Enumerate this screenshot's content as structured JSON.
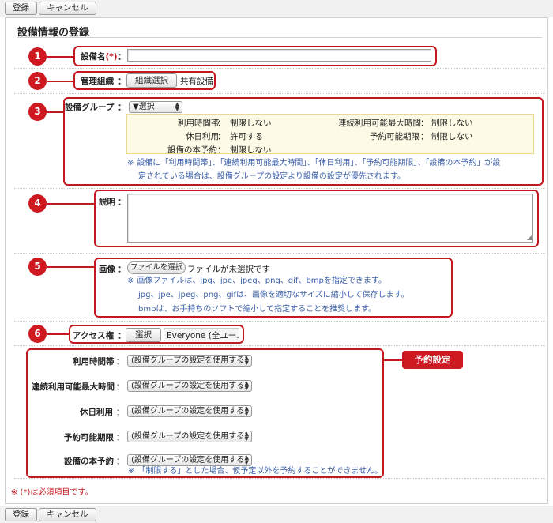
{
  "toolbar": {
    "register": "登録",
    "cancel": "キャンセル"
  },
  "page_title": "設備情報の登録",
  "badges": [
    "1",
    "2",
    "3",
    "4",
    "5",
    "6"
  ],
  "facility_name": {
    "label": "設備名",
    "required_mark": "(*)",
    "value": ""
  },
  "org": {
    "label": "管理組織",
    "button": "組織選択",
    "value": "共有設備"
  },
  "group": {
    "label": "設備グループ",
    "select": "▼選択",
    "details": [
      {
        "label": "利用時間帯",
        "value": "制限しない"
      },
      {
        "label": "連続利用可能最大時間",
        "value": "制限しない"
      },
      {
        "label": "休日利用",
        "value": "許可する"
      },
      {
        "label": "予約可能期限",
        "value": "制限しない"
      },
      {
        "label": "設備の本予約",
        "value": "制限しない"
      }
    ],
    "note_line1": "設備に「利用時間帯」、「連続利用可能最大時間」、「休日利用」、「予約可能期限」、「設備の本予約」が設",
    "note_line2": "定されている場合は、設備グループの設定より設備の設定が優先されます。"
  },
  "description": {
    "label": "説明",
    "value": ""
  },
  "image": {
    "label": "画像",
    "file_button": "ファイルを選択",
    "file_status": "ファイルが未選択です",
    "note1": "画像ファイルは、jpg、jpe、jpeg、png、gif、bmpを指定できます。",
    "note2": "jpg、jpe、jpeg、png、gifは、画像を適切なサイズに縮小して保存します。",
    "note3": "bmpは、お手持ちのソフトで縮小して指定することを推奨します。"
  },
  "access": {
    "label": "アクセス権",
    "button": "選択",
    "value": "Everyone (全ユー…"
  },
  "reservation": {
    "tag": "予約設定",
    "rows": [
      {
        "label": "利用時間帯",
        "value": "(設備グループの設定を使用する)"
      },
      {
        "label": "連続利用可能最大時間",
        "value": "(設備グループの設定を使用する)"
      },
      {
        "label": "休日利用",
        "value": "(設備グループの設定を使用する)"
      },
      {
        "label": "予約可能期限",
        "value": "(設備グループの設定を使用する)"
      },
      {
        "label": "設備の本予約",
        "value": "(設備グループの設定を使用する)"
      }
    ],
    "note": "「制限する」とした場合、仮予定以外を予約することができません。"
  },
  "note_mark": "※",
  "colon": "：",
  "footnote": "※ (*)は必須項目です。",
  "colors": {
    "accent_red": "#c4171f",
    "note_blue": "#3a5fa8",
    "highlight_bg": "#fdfbe6"
  }
}
